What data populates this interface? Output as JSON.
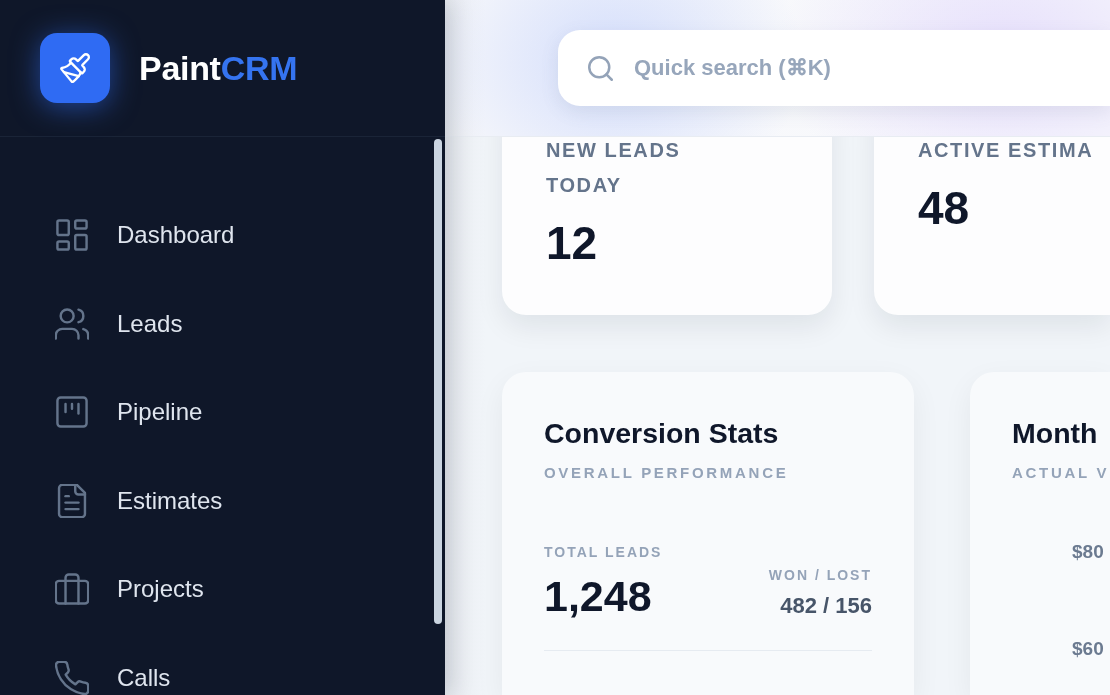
{
  "sidebar": {
    "brand": {
      "name": "Paint",
      "accent": "CRM"
    },
    "nav_items": [
      {
        "label": "Dashboard"
      },
      {
        "label": "Leads"
      },
      {
        "label": "Pipeline"
      },
      {
        "label": "Estimates"
      },
      {
        "label": "Projects"
      },
      {
        "label": "Calls"
      }
    ]
  },
  "header": {
    "search": {
      "placeholder": "Quick search (⌘K)"
    }
  },
  "stat_cards": [
    {
      "label": "NEW LEADS TODAY",
      "value": "12"
    },
    {
      "label": "ACTIVE ESTIMA",
      "value": "48"
    }
  ],
  "conversion_stats": {
    "title": "Conversion Stats",
    "subtitle": "OVERALL PERFORMANCE",
    "total_label": "TOTAL LEADS",
    "total_value": "1,248",
    "won_lost_label": "WON / LOST",
    "won_lost_value": "482 / 156"
  },
  "monthly_card": {
    "title": "Month",
    "subtitle": "ACTUAL V",
    "y_axis_labels": [
      "$80",
      "$60"
    ]
  }
}
